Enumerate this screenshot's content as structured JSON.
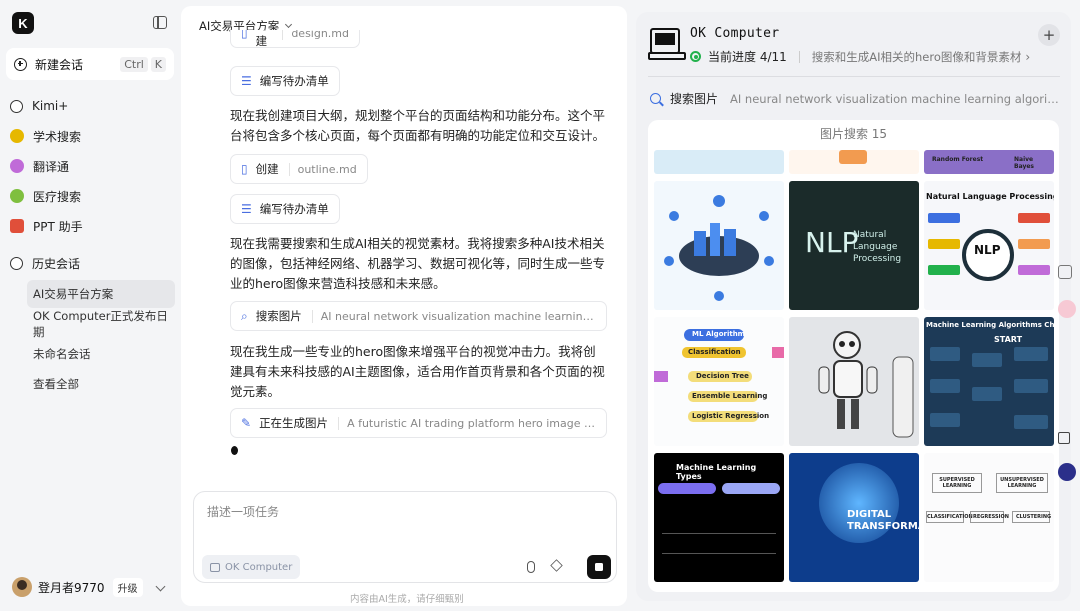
{
  "sidebar": {
    "new_chat": "新建会话",
    "kbd_ctrl": "Ctrl",
    "kbd_k": "K",
    "nav": [
      {
        "label": "Kimi+",
        "icon": "kimi-plus-icon",
        "color": "#333"
      },
      {
        "label": "学术搜索",
        "icon": "academic-search-icon",
        "color": "#e6b800"
      },
      {
        "label": "翻译通",
        "icon": "translate-icon",
        "color": "#c06bd8"
      },
      {
        "label": "医疗搜索",
        "icon": "medical-search-icon",
        "color": "#7fbf3f"
      },
      {
        "label": "PPT 助手",
        "icon": "ppt-icon",
        "color": "#e04f3a"
      }
    ],
    "history_title": "历史会话",
    "history": [
      "AI交易平台方案",
      "OK Computer正式发布日期",
      "未命名会话",
      "查看全部"
    ],
    "user_name": "登月者9770",
    "upgrade": "升级"
  },
  "chat": {
    "title": "AI交易平台方案",
    "chips": [
      {
        "label": "创建",
        "sub": "design.md"
      },
      {
        "label": "编写待办清单",
        "sub": ""
      },
      {
        "label": "创建",
        "sub": "outline.md"
      },
      {
        "label": "编写待办清单",
        "sub": ""
      },
      {
        "label": "搜索图片",
        "sub": "AI neural network visualization machine learning algorithm"
      },
      {
        "label": "正在生成图片",
        "sub": "A futuristic AI trading platform hero image featuring a"
      }
    ],
    "messages": [
      "现在我创建项目大纲，规划整个平台的页面结构和功能分布。这个平台将包含多个核心页面，每个页面都有明确的功能定位和交互设计。",
      "现在我需要搜索和生成AI相关的视觉素材。我将搜索多种AI技术相关的图像，包括神经网络、机器学习、数据可视化等，同时生成一些专业的hero图像来营造科技感和未来感。",
      "现在我生成一些专业的hero图像来增强平台的视觉冲击力。我将创建具有未来科技感的AI主题图像，适合用作首页背景和各个页面的视觉元素。"
    ],
    "input_placeholder": "描述一项任务",
    "okc_chip": "OK Computer",
    "disclaimer": "内容由AI生成，请仔细甄别"
  },
  "panel": {
    "title": "OK Computer",
    "progress_label": "当前进度 4/11",
    "current_step": "搜索和生成AI相关的hero图像和背景素材",
    "search_label": "搜索图片",
    "search_query": "AI neural network visualization machine learning algorithm...",
    "image_header": "图片搜索 15",
    "thumb_texts": {
      "nlp1": "NLP",
      "nlp1_sub": "Natural Language Processing",
      "nlp2_title": "Natural Language Processing",
      "nlp2_center": "NLP",
      "ml_algo": "ML Algorithm",
      "classification": "Classification",
      "decision_tree": "Decision Tree",
      "ensemble": "Ensemble Learning",
      "logistic": "Logistic Regression",
      "cheat": "Machine Learning Algorithms Cheat Sheet",
      "start": "START",
      "ml_types": "Machine Learning Types",
      "digital": "DIGITAL TRANSFORMA",
      "supervised": "SUPERVISED LEARNING",
      "unsupervised": "UNSUPERVISED LEARNING",
      "classification2": "CLASSIFICATION",
      "regression": "REGRESSION",
      "clustering": "CLUSTERING",
      "random_forest": "Random Forest",
      "naive_bayes": "Naive Bayes"
    }
  },
  "colors": {
    "accent": "#3c6fe0",
    "status": "#22b14c"
  }
}
